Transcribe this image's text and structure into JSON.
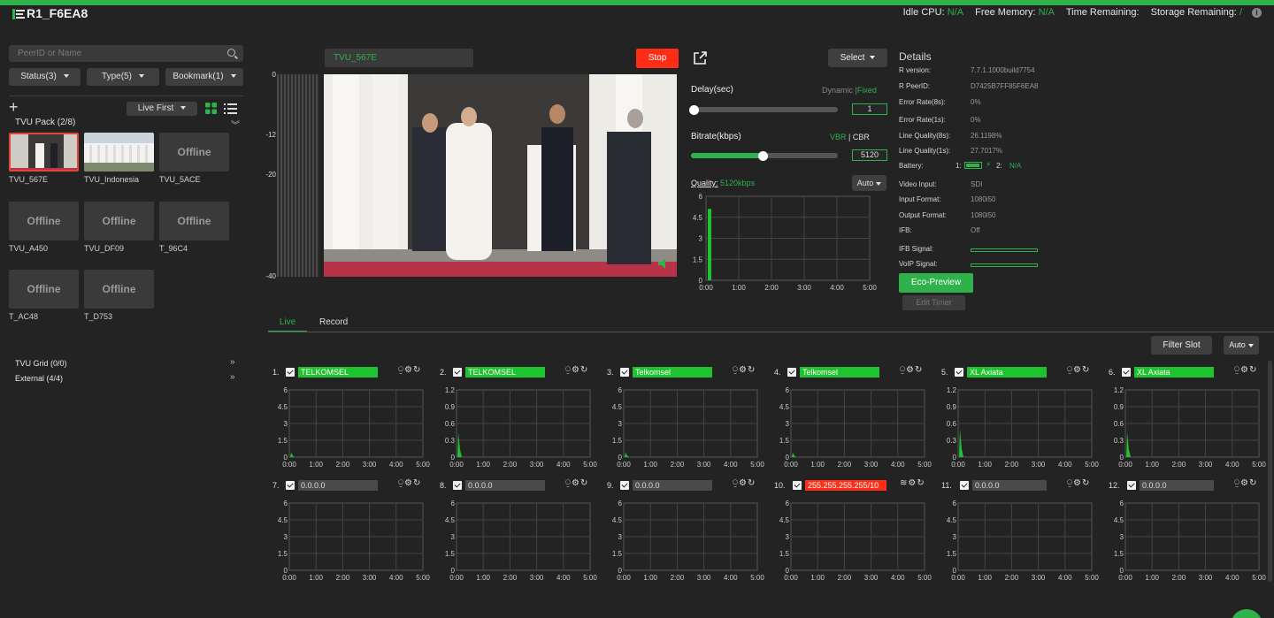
{
  "header": {
    "title": "R1_F6EA8",
    "stats": [
      {
        "label": "Idle CPU:",
        "value": "N/A"
      },
      {
        "label": "Free Memory:",
        "value": "N/A"
      },
      {
        "label": "Time Remaining:",
        "value": ""
      },
      {
        "label": "Storage Remaining:",
        "value": "/"
      }
    ],
    "info_glyph": "i"
  },
  "sidebar": {
    "search_placeholder": "PeerID or Name",
    "filters": [
      "Status(3)",
      "Type(5)",
      "Bookmark(1)"
    ],
    "sort_label": "Live First",
    "pack_title": "TVU Pack (2/8)",
    "offline_text": "Offline",
    "sources": [
      {
        "name": "TVU_567E",
        "online": true,
        "selected": true
      },
      {
        "name": "TVU_Indonesia",
        "online": true,
        "selected": false
      },
      {
        "name": "TVU_5ACE",
        "online": false
      },
      {
        "name": "TVU_A450",
        "online": false
      },
      {
        "name": "TVU_DF09",
        "online": false
      },
      {
        "name": "T_96C4",
        "online": false
      },
      {
        "name": "T_AC48",
        "online": false
      },
      {
        "name": "T_D753",
        "online": false
      }
    ],
    "groups": [
      {
        "label": "TVU Grid (0/0)"
      },
      {
        "label": "External (4/4)"
      }
    ]
  },
  "player": {
    "source_name": "TVU_567E",
    "stop_label": "Stop",
    "meter_ticks": [
      "0",
      "-12",
      "-20",
      "-40"
    ]
  },
  "controls": {
    "select_label": "Select",
    "delay_label": "Delay(sec)",
    "delay_modes": [
      "Dynamic",
      "Fixed"
    ],
    "delay_value": "1",
    "delay_fraction": 0.0,
    "bitrate_label": "Bitrate(kbps)",
    "bitrate_modes": [
      "VBR",
      "CBR"
    ],
    "bitrate_value": "5120",
    "bitrate_fraction": 0.49,
    "quality_label": "Quality:",
    "quality_value": "5120kbps",
    "auto_label": "Auto"
  },
  "details": {
    "title": "Details",
    "rows": [
      {
        "label": "R version:",
        "value": "7.7.1.1000build7754"
      },
      {
        "label": "R PeerID:",
        "value": "D7425B7FF85F6EA8"
      },
      {
        "label": "Error Rate(8s):",
        "value": "0%"
      },
      {
        "label": "Error Rate(1s):",
        "value": "0%"
      },
      {
        "label": "Line Quality(8s):",
        "value": "26.1198%"
      },
      {
        "label": "Line Quality(1s):",
        "value": "27.7017%"
      }
    ],
    "battery_label": "Battery:",
    "battery_1": "1:",
    "battery_2": "2:",
    "battery_2_value": "N/A",
    "rows2": [
      {
        "label": "Video Input:",
        "value": "SDI"
      },
      {
        "label": "Input Format:",
        "value": "1080i50"
      },
      {
        "label": "Output Format:",
        "value": "1080i50"
      },
      {
        "label": "IFB:",
        "value": "Off"
      }
    ],
    "ifb_signal_label": "IFB Signal:",
    "voip_signal_label": "VoIP Signal:",
    "eco_label": "Eco-Preview",
    "edit_timer_label": "Edit Timer"
  },
  "tabs": [
    {
      "label": "Live"
    },
    {
      "label": "Record"
    }
  ],
  "toolbar": {
    "filter_label": "Filter Slot",
    "auto_label": "Auto"
  },
  "colors": {
    "accent": "#2fb24a",
    "stop": "#ff2d16",
    "link_green": "#1fc22f"
  },
  "chart_data": [
    {
      "type": "bar",
      "title": "Quality",
      "x": [
        "0:00",
        "1:00",
        "2:00",
        "3:00",
        "4:00",
        "5:00"
      ],
      "yticks": [
        "0",
        "1.5",
        "3",
        "4.5",
        "6"
      ],
      "ylim": [
        0,
        6
      ],
      "values": [
        5.1
      ]
    },
    {
      "type": "area",
      "slots": [
        {
          "num": "1.",
          "name": "TELKOMSEL",
          "state": "green",
          "yticks": [
            "0",
            "1.5",
            "3",
            "4.5",
            "6"
          ],
          "ymax": 6,
          "spike": 0.4
        },
        {
          "num": "2.",
          "name": "TELKOMSEL",
          "state": "green",
          "yticks": [
            "0",
            "0.3",
            "0.6",
            "0.9",
            "1.2"
          ],
          "ymax": 1.2,
          "spike": 0.45
        },
        {
          "num": "3.",
          "name": "Telkomsel",
          "state": "green",
          "yticks": [
            "0",
            "1.5",
            "3",
            "4.5",
            "6"
          ],
          "ymax": 6,
          "spike": 0.4
        },
        {
          "num": "4.",
          "name": "Telkomsel",
          "state": "green",
          "yticks": [
            "0",
            "1.5",
            "3",
            "4.5",
            "6"
          ],
          "ymax": 6,
          "spike": 0.4
        },
        {
          "num": "5.",
          "name": "XL Axiata",
          "state": "green",
          "yticks": [
            "0",
            "0.3",
            "0.6",
            "0.9",
            "1.2"
          ],
          "ymax": 1.2,
          "spike": 0.5
        },
        {
          "num": "6.",
          "name": "XL Axiata",
          "state": "green",
          "yticks": [
            "0",
            "0.3",
            "0.6",
            "0.9",
            "1.2"
          ],
          "ymax": 1.2,
          "spike": 0.45
        },
        {
          "num": "7.",
          "name": "0.0.0.0",
          "state": "gray",
          "yticks": [
            "0",
            "1.5",
            "3",
            "4.5",
            "6"
          ],
          "ymax": 6,
          "spike": 0
        },
        {
          "num": "8.",
          "name": "0.0.0.0",
          "state": "gray",
          "yticks": [
            "0",
            "1.5",
            "3",
            "4.5",
            "6"
          ],
          "ymax": 6,
          "spike": 0
        },
        {
          "num": "9.",
          "name": "0.0.0.0",
          "state": "gray",
          "yticks": [
            "0",
            "1.5",
            "3",
            "4.5",
            "6"
          ],
          "ymax": 6,
          "spike": 0
        },
        {
          "num": "10.",
          "name": "255.255.255.255/10",
          "state": "red",
          "yticks": [
            "0",
            "1.5",
            "3",
            "4.5",
            "6"
          ],
          "ymax": 6,
          "spike": 0
        },
        {
          "num": "11.",
          "name": "0.0.0.0",
          "state": "gray",
          "yticks": [
            "0",
            "1.5",
            "3",
            "4.5",
            "6"
          ],
          "ymax": 6,
          "spike": 0
        },
        {
          "num": "12.",
          "name": "0.0.0.0",
          "state": "gray",
          "yticks": [
            "0",
            "1.5",
            "3",
            "4.5",
            "6"
          ],
          "ymax": 6,
          "spike": 0
        }
      ],
      "x": [
        "0:00",
        "1:00",
        "2:00",
        "3:00",
        "4:00",
        "5:00"
      ]
    }
  ]
}
